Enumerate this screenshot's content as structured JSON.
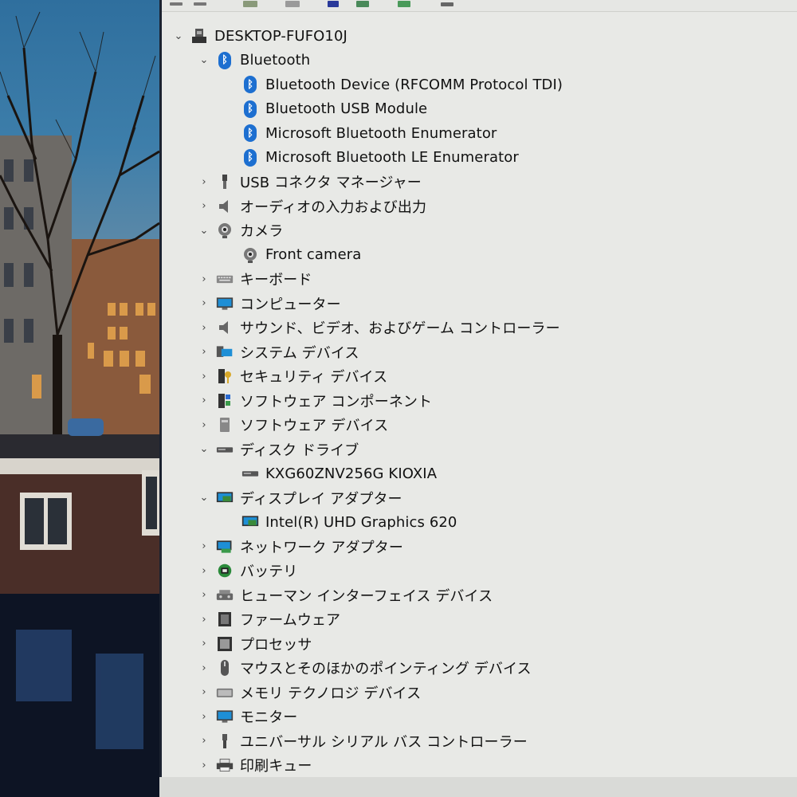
{
  "tree": {
    "root": {
      "label": "DESKTOP-FUFO10J",
      "icon": "computer-root-icon",
      "expanded": true
    },
    "items": [
      {
        "label": "Bluetooth",
        "icon": "bluetooth-icon",
        "level": 1,
        "expanded": true,
        "has_children": true
      },
      {
        "label": "Bluetooth Device (RFCOMM Protocol TDI)",
        "icon": "bluetooth-icon",
        "level": 2,
        "has_children": false
      },
      {
        "label": "Bluetooth USB Module",
        "icon": "bluetooth-icon",
        "level": 2,
        "has_children": false
      },
      {
        "label": "Microsoft Bluetooth Enumerator",
        "icon": "bluetooth-icon",
        "level": 2,
        "has_children": false
      },
      {
        "label": "Microsoft Bluetooth LE Enumerator",
        "icon": "bluetooth-icon",
        "level": 2,
        "has_children": false
      },
      {
        "label": "USB コネクタ マネージャー",
        "icon": "usb-connector-icon",
        "level": 1,
        "expanded": false,
        "has_children": true
      },
      {
        "label": "オーディオの入力および出力",
        "icon": "speaker-icon",
        "level": 1,
        "expanded": false,
        "has_children": true
      },
      {
        "label": "カメラ",
        "icon": "camera-icon",
        "level": 1,
        "expanded": true,
        "has_children": true
      },
      {
        "label": "Front camera",
        "icon": "camera-icon",
        "level": 2,
        "has_children": false
      },
      {
        "label": "キーボード",
        "icon": "keyboard-icon",
        "level": 1,
        "expanded": false,
        "has_children": true
      },
      {
        "label": "コンピューター",
        "icon": "monitor-icon",
        "level": 1,
        "expanded": false,
        "has_children": true
      },
      {
        "label": "サウンド、ビデオ、およびゲーム コントローラー",
        "icon": "speaker-icon",
        "level": 1,
        "expanded": false,
        "has_children": true
      },
      {
        "label": "システム デバイス",
        "icon": "system-device-icon",
        "level": 1,
        "expanded": false,
        "has_children": true
      },
      {
        "label": "セキュリティ デバイス",
        "icon": "security-device-icon",
        "level": 1,
        "expanded": false,
        "has_children": true
      },
      {
        "label": "ソフトウェア コンポーネント",
        "icon": "software-component-icon",
        "level": 1,
        "expanded": false,
        "has_children": true
      },
      {
        "label": "ソフトウェア デバイス",
        "icon": "software-device-icon",
        "level": 1,
        "expanded": false,
        "has_children": true
      },
      {
        "label": "ディスク ドライブ",
        "icon": "disk-drive-icon",
        "level": 1,
        "expanded": true,
        "has_children": true
      },
      {
        "label": "KXG60ZNV256G KIOXIA",
        "icon": "disk-drive-icon",
        "level": 2,
        "has_children": false
      },
      {
        "label": "ディスプレイ アダプター",
        "icon": "display-adapter-icon",
        "level": 1,
        "expanded": true,
        "has_children": true
      },
      {
        "label": "Intel(R) UHD Graphics 620",
        "icon": "display-adapter-icon",
        "level": 2,
        "has_children": false
      },
      {
        "label": "ネットワーク アダプター",
        "icon": "network-adapter-icon",
        "level": 1,
        "expanded": false,
        "has_children": true
      },
      {
        "label": "バッテリ",
        "icon": "battery-icon",
        "level": 1,
        "expanded": false,
        "has_children": true
      },
      {
        "label": "ヒューマン インターフェイス デバイス",
        "icon": "hid-icon",
        "level": 1,
        "expanded": false,
        "has_children": true
      },
      {
        "label": "ファームウェア",
        "icon": "firmware-icon",
        "level": 1,
        "expanded": false,
        "has_children": true
      },
      {
        "label": "プロセッサ",
        "icon": "processor-icon",
        "level": 1,
        "expanded": false,
        "has_children": true
      },
      {
        "label": "マウスとそのほかのポインティング デバイス",
        "icon": "mouse-icon",
        "level": 1,
        "expanded": false,
        "has_children": true
      },
      {
        "label": "メモリ テクノロジ デバイス",
        "icon": "memory-device-icon",
        "level": 1,
        "expanded": false,
        "has_children": true
      },
      {
        "label": "モニター",
        "icon": "monitor-icon",
        "level": 1,
        "expanded": false,
        "has_children": true
      },
      {
        "label": "ユニバーサル シリアル バス コントローラー",
        "icon": "usb-controller-icon",
        "level": 1,
        "expanded": false,
        "has_children": true
      },
      {
        "label": "印刷キュー",
        "icon": "printer-icon",
        "level": 1,
        "expanded": false,
        "has_children": true
      }
    ]
  },
  "toolbar": {
    "buttons": [
      {
        "icon": "back-arrow-icon"
      },
      {
        "icon": "forward-arrow-icon"
      },
      {
        "icon": "properties-icon"
      },
      {
        "icon": "help-icon"
      },
      {
        "icon": "scan-hardware-icon"
      },
      {
        "icon": "update-driver-icon"
      },
      {
        "icon": "uninstall-device-icon"
      },
      {
        "icon": "disable-device-icon"
      }
    ]
  },
  "colors": {
    "window_bg": "#e8e9e6",
    "bluetooth_blue": "#1d6fd0",
    "text": "#111111"
  }
}
